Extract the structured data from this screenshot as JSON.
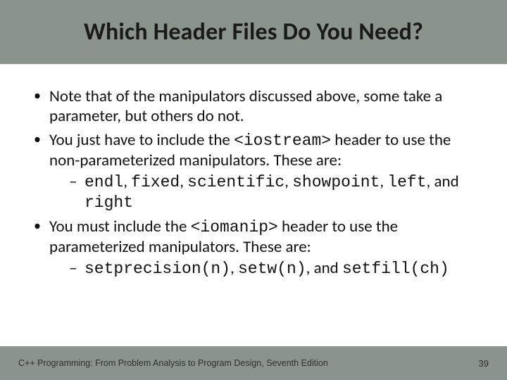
{
  "title": "Which Header Files Do You Need?",
  "bullets": {
    "b1": "Note that of the manipulators discussed above, some take a parameter, but others do not.",
    "b2_pre": "You just have to include the ",
    "b2_code": "<iostream>",
    "b2_post": " header to use the non-parameterized manipulators.  These are:",
    "b2_sub_pre": "",
    "b2_sub_c1": "endl",
    "b2_sub_t1": ", ",
    "b2_sub_c2": "fixed",
    "b2_sub_t2": ", ",
    "b2_sub_c3": "scientific",
    "b2_sub_t3": ", ",
    "b2_sub_c4": "showpoint",
    "b2_sub_t4": ", ",
    "b2_sub_c5": "left",
    "b2_sub_t5": ", and ",
    "b2_sub_c6": "right",
    "b3_pre": "You must include the ",
    "b3_code": "<iomanip>",
    "b3_post": " header to use the parameterized manipulators.  These are:",
    "b3_sub_c1": "setprecision(n)",
    "b3_sub_t1": ", ",
    "b3_sub_c2": "setw(n)",
    "b3_sub_t2": ", and ",
    "b3_sub_c3": "setfill(ch)"
  },
  "footer": "C++ Programming: From Problem Analysis to Program Design, Seventh Edition",
  "page": "39"
}
